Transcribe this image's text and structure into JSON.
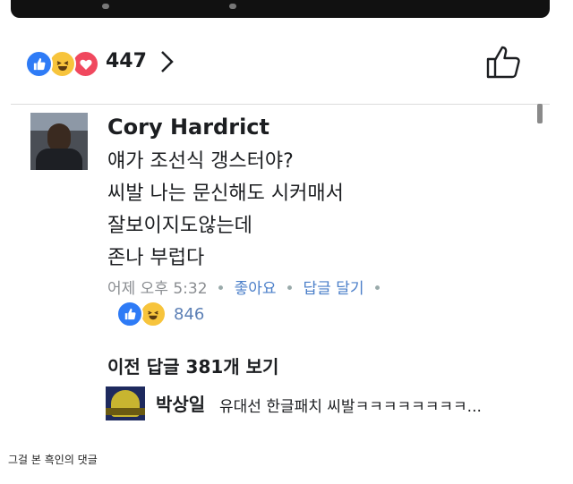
{
  "header": {
    "reaction_count": "447",
    "colors": {
      "like": "#2e7bf6",
      "haha": "#f7c43c",
      "love": "#f0485e"
    },
    "icons": [
      "like-reaction-icon",
      "haha-reaction-icon",
      "love-reaction-icon",
      "chevron-right-icon",
      "thumbs-up-icon"
    ]
  },
  "comment": {
    "author": "Cory Hardrict",
    "lines": [
      "얘가 조선식 갱스터야?",
      "씨발 나는 문신해도 시커매서",
      "잘보이지도않는데",
      "존나 부럽다"
    ],
    "timestamp": "어제 오후 5:32",
    "like_label": "좋아요",
    "reply_label": "답글 달기",
    "separator": "•",
    "reaction_count": "846"
  },
  "replies": {
    "view_previous": "이전 답글 381개 보기",
    "latest": {
      "author": "박상일",
      "text": "유대선 한글패치 씨발ㅋㅋㅋㅋㅋㅋㅋㅋ..."
    }
  },
  "caption": "그걸 본 흑인의 댓글"
}
